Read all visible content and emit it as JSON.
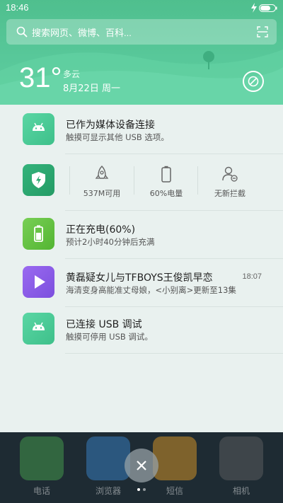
{
  "status_bar": {
    "time": "18:46"
  },
  "search": {
    "placeholder": "搜索网页、微博、百科..."
  },
  "weather": {
    "temperature": "31°",
    "condition": "多云",
    "date": "8月22日 周一"
  },
  "notifications": [
    {
      "title": "已作为媒体设备连接",
      "subtitle": "触摸可显示其他 USB 选项。"
    },
    {
      "title": "正在充电(60%)",
      "subtitle": "预计2小时40分钟后充满"
    },
    {
      "title": "黄磊疑女儿与TFBOYS王俊凯早恋",
      "subtitle": "海清变身高能准丈母娘，<小别离>更新至13集",
      "time": "18:07"
    },
    {
      "title": "已连接 USB 调试",
      "subtitle": "触摸可停用 USB 调试。"
    }
  ],
  "quick_stats": {
    "memory": "537M可用",
    "battery": "60%电量",
    "blocked": "无新拦截"
  },
  "dock": {
    "items": [
      {
        "label": "电话",
        "color": "#4caf50"
      },
      {
        "label": "浏览器",
        "color": "#3b8fd9"
      },
      {
        "label": "短信",
        "color": "#f5a623"
      },
      {
        "label": "相机",
        "color": "#666666"
      }
    ]
  },
  "colors": {
    "accent": "#58c89a",
    "panel": "#e9f1ef"
  }
}
